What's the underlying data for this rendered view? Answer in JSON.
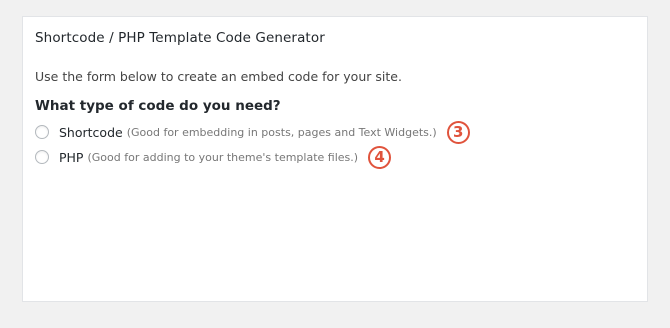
{
  "panel": {
    "title": "Shortcode / PHP Template Code Generator",
    "intro": "Use the form below to create an embed code for your site.",
    "question": "What type of code do you need?"
  },
  "options": [
    {
      "label": "Shortcode",
      "description": "(Good for embedding in posts, pages and Text Widgets.)",
      "badge": "3",
      "checked": false
    },
    {
      "label": "PHP",
      "description": "(Good for adding to your theme's template files.)",
      "badge": "4",
      "checked": false
    }
  ],
  "colors": {
    "badge": "#e0533c",
    "background": "#f1f1f1",
    "panel": "#ffffff"
  }
}
